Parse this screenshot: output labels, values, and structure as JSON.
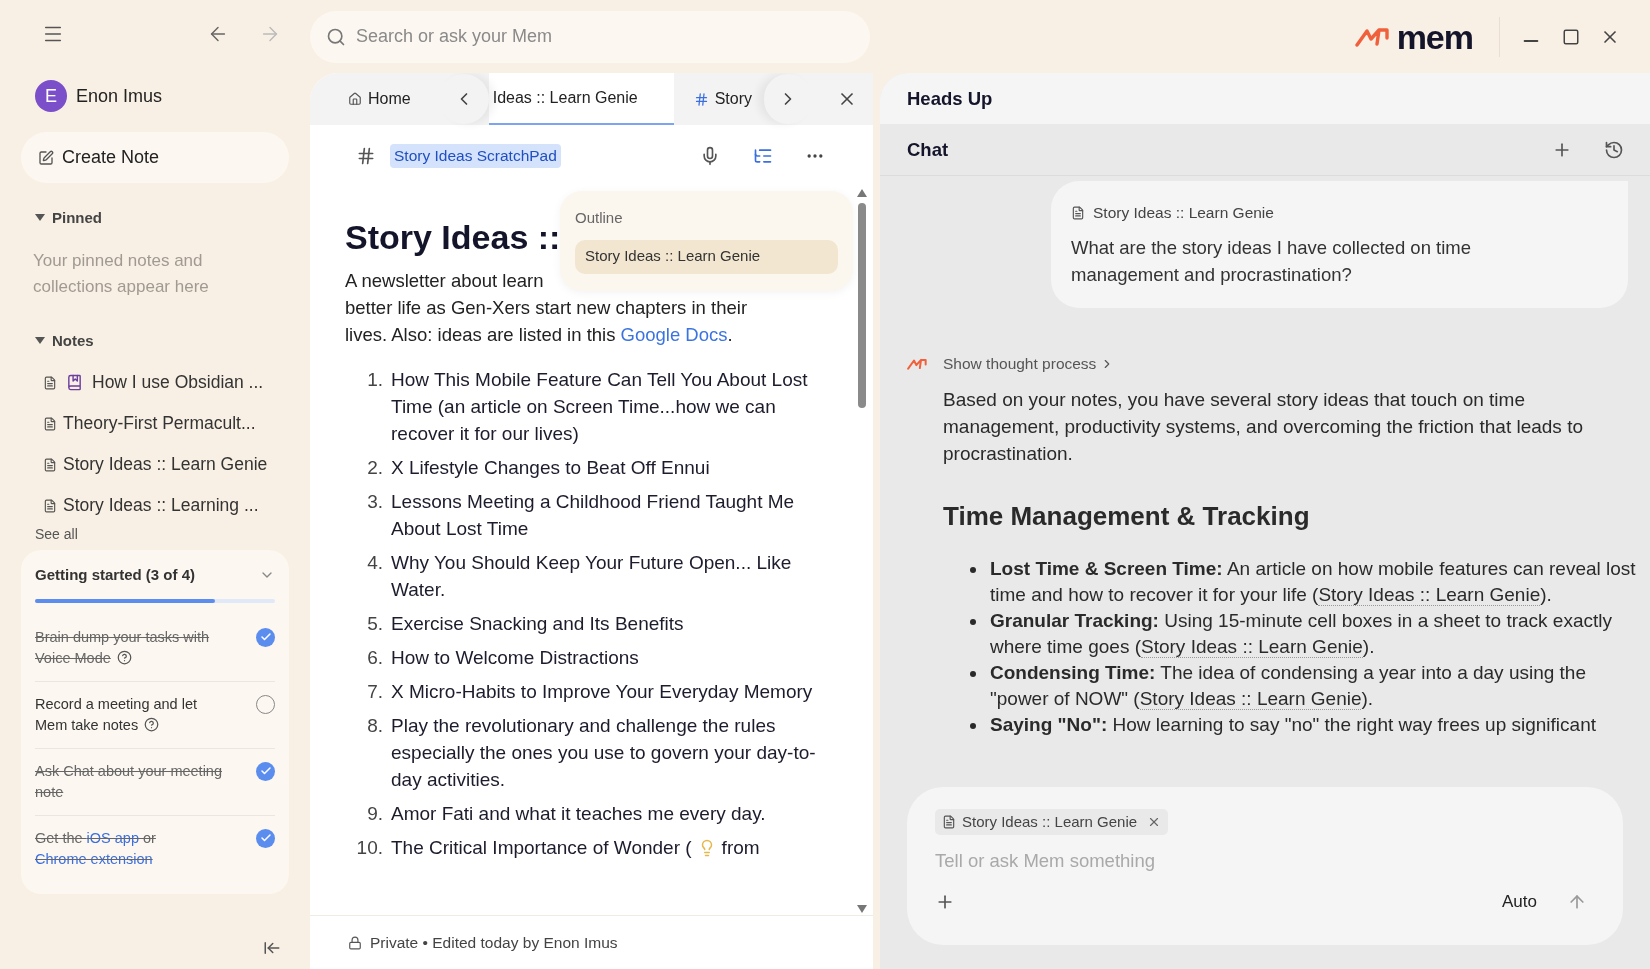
{
  "sidebar": {
    "nav": {
      "back_disabled": false,
      "forward_disabled": true
    },
    "user": {
      "initial": "E",
      "name": "Enon Imus"
    },
    "create_button": "Create Note",
    "pinned": {
      "label": "Pinned",
      "expanded": true,
      "empty_text": "Your pinned notes and collections appear here"
    },
    "notes": {
      "label": "Notes",
      "expanded": true,
      "items": [
        {
          "title": "How I use Obsidian ...",
          "kind": "book"
        },
        {
          "title": "Theory-First Permacult...",
          "kind": "plain"
        },
        {
          "title": "Story Ideas :: Learn Genie",
          "kind": "plain"
        },
        {
          "title": "Story Ideas :: Learning ...",
          "kind": "plain"
        }
      ],
      "see_all": "See all"
    },
    "getting_started": {
      "title": "Getting started (3 of 4)",
      "level": 0.75,
      "tasks": [
        {
          "parts": [
            {
              "text": "Brain dump your tasks with Voice Mode"
            }
          ],
          "help": true,
          "checked": true
        },
        {
          "parts": [
            {
              "text": "Record a meeting and let Mem take notes"
            }
          ],
          "help": true,
          "checked": false
        },
        {
          "parts": [
            {
              "text": "Ask Chat about your meeting note"
            }
          ],
          "help": false,
          "checked": true
        },
        {
          "parts": [
            {
              "text": "Get the "
            },
            {
              "text": "iOS app",
              "link": true
            },
            {
              "text": " or "
            },
            {
              "text": "Chrome extension",
              "link": true
            }
          ],
          "help": false,
          "checked": true
        }
      ]
    }
  },
  "search": {
    "placeholder": "Search or ask your Mem"
  },
  "logo_text": "mem",
  "note_panel": {
    "tabs": [
      {
        "label": "Home",
        "kind": "home",
        "selected": false
      },
      {
        "label": "Ideas :: Learn Genie",
        "kind": "note",
        "selected": true
      },
      {
        "label": "Story",
        "kind": "collection",
        "selected": false
      }
    ],
    "tag": "Story Ideas ScratchPad",
    "outline": {
      "title": "Outline",
      "items": [
        {
          "label": "Story Ideas :: Learn Genie",
          "selected": true
        }
      ]
    },
    "title": "Story Ideas ::",
    "intro_first_line": "A newsletter about learn",
    "intro_rest": "better life as Gen-Xers start new chapters in their lives. Also: ideas are listed in this",
    "intro_link": "Google Docs",
    "intro_end": ".",
    "list": [
      {
        "number": "1.",
        "text": "How This Mobile Feature Can Tell You About Lost Time (an article on Screen Time...how we can recover it for our lives)"
      },
      {
        "number": "2.",
        "text": "X Lifestyle Changes to Beat Off Ennui"
      },
      {
        "number": "3.",
        "text": "Lessons Meeting a Childhood Friend Taught Me About Lost Time"
      },
      {
        "number": "4.",
        "text": "Why You Should Keep Your Future Open... Like Water."
      },
      {
        "number": "5.",
        "text": "Exercise Snacking and Its Benefits"
      },
      {
        "number": "6.",
        "text": "How to Welcome Distractions"
      },
      {
        "number": "7.",
        "text": "X Micro-Habits to Improve Your Everyday Memory"
      },
      {
        "number": "8.",
        "text": "Play the revolutionary and challenge the rules especially the ones you use to govern your day-to-day activities."
      },
      {
        "number": "9.",
        "text": "Amor Fati and what it teaches me every day."
      },
      {
        "number": "10.",
        "text": "The Critical Importance of Wonder (",
        "kind": "lightbulb",
        "text_after": "from"
      }
    ],
    "footer": "Private • Edited today by Enon Imus"
  },
  "chat_panel": {
    "heads_up": "Heads Up",
    "title": "Chat",
    "user_message": {
      "attachment": "Story Ideas :: Learn Genie",
      "text": "What are the story ideas I have collected on time management and procrastination?"
    },
    "thought_toggle": "Show thought process",
    "answer_intro": "Based on your notes, you have several story ideas that touch on time management, productivity systems, and overcoming the friction that leads to procrastination.",
    "heading": "Time Management & Tracking",
    "bullets": [
      {
        "label": "Lost Time & Screen Time:",
        "text": " An article on how mobile features can reveal lost time and how to recover it for your life (",
        "link": "Story Ideas :: Learn Genie",
        "end": ")."
      },
      {
        "label": "Granular Tracking:",
        "text": " Using 15-minute cell boxes in a sheet to track exactly where time goes (",
        "link": "Story Ideas :: Learn Genie",
        "end": ")."
      },
      {
        "label": "Condensing Time:",
        "text": " The idea of condensing a year into a day using the \"power of NOW\" (",
        "link": "Story Ideas :: Learn Genie",
        "end": ")."
      },
      {
        "label": "Saying \"No\":",
        "text": " How learning to say \"no\" the right way frees up significant"
      }
    ],
    "composer": {
      "chip": "Story Ideas :: Learn Genie",
      "placeholder": "Tell or ask Mem something",
      "mode": "Auto"
    }
  }
}
